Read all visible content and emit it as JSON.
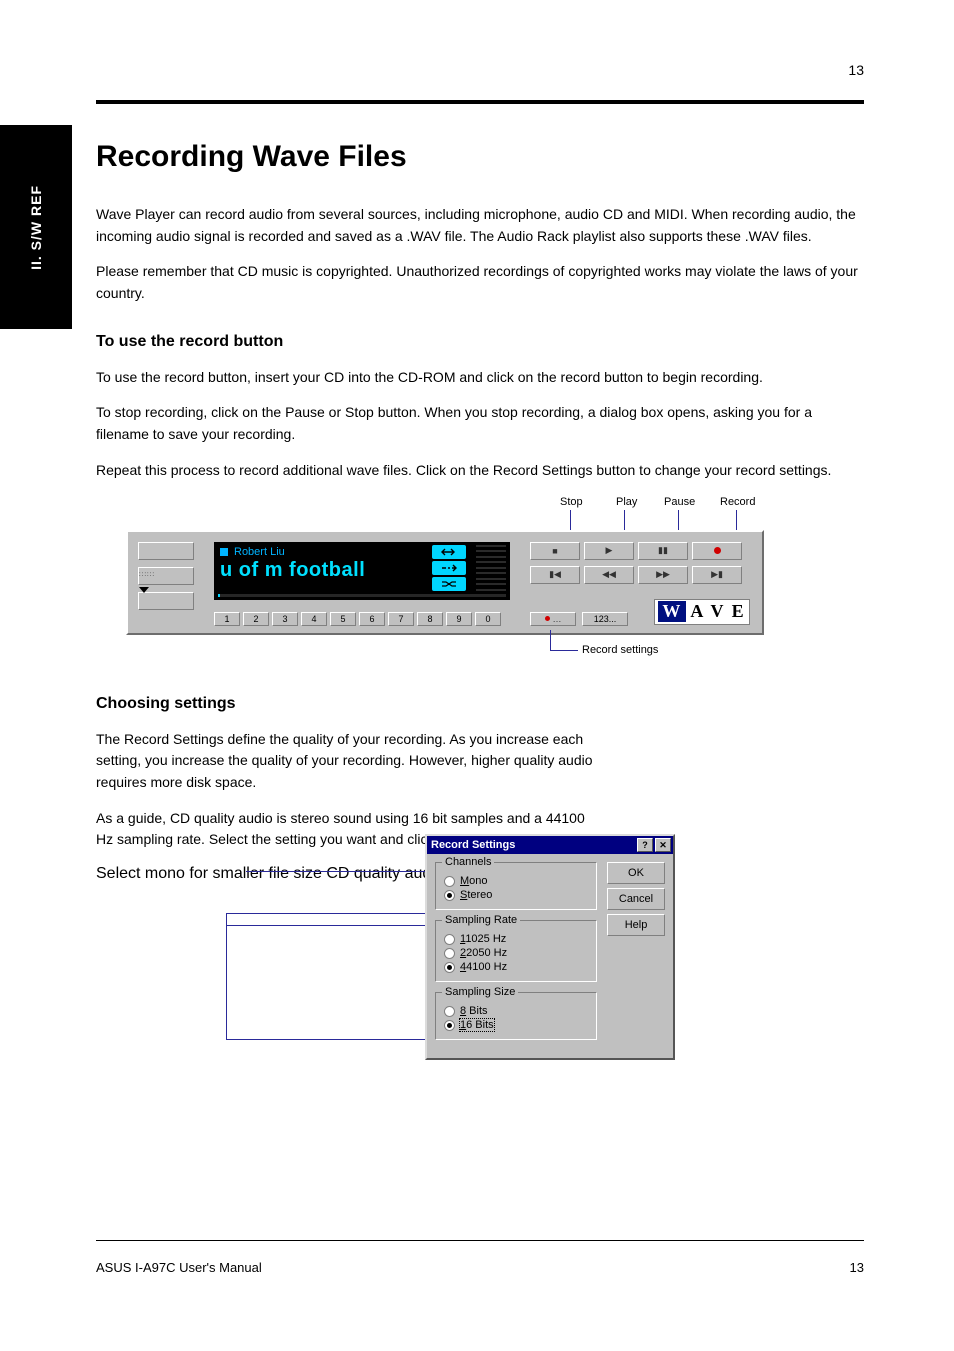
{
  "page_number_top": "13",
  "section_title": "Recording Wave Files",
  "sidebar_label": "II. S/W REF",
  "intro_para1": "Wave Player can record audio from several sources, including microphone, audio CD and MIDI. When recording audio, the incoming audio signal is recorded and saved as a .WAV file. The Audio Rack playlist also supports these .WAV files.",
  "intro_para2": "Please remember that CD music is copyrighted. Unauthorized recordings of copyrighted works may violate the laws of your country.",
  "para_record1": "To use the record button, insert your CD into the CD-ROM and click on the record button to begin recording.",
  "para_record2": "To stop recording, click on the Pause or Stop button. When you stop recording, a dialog box opens, asking you for a filename to save your recording.",
  "para_record3": "Repeat this process to record additional wave files. Click on the Record Settings button to change your record settings.",
  "subhead_use_record": "To use the record button",
  "subhead_settings": "Choosing settings",
  "label_stop": "Stop",
  "label_play": "Play",
  "label_pause": "Pause",
  "label_record": "Record",
  "label_record_settings": "Record settings",
  "wave": {
    "artist": "Robert Liu",
    "title": "u of m football",
    "nums": [
      "1",
      "2",
      "3",
      "4",
      "5",
      "6",
      "7",
      "8",
      "9",
      "0"
    ],
    "bot_btn2": "123...",
    "logo_rest": " A V E"
  },
  "settings": {
    "para1": "The Record Settings define the quality of your recording. As you increase each setting, you increase the quality of your recording. However, higher quality audio requires more disk space.",
    "para2": "As a guide, CD quality audio is stereo sound using 16 bit samples and a 44100 Hz sampling rate. Select the setting you want and click OK.",
    "callout_mono": "Select mono for smaller file size",
    "callout_cd": "CD quality audio settings",
    "dialog_title": "Record Settings",
    "legend_channels": "Channels",
    "legend_rate": "Sampling Rate",
    "legend_size": "Sampling Size",
    "opt_mono": "Mono",
    "opt_stereo": "Stereo",
    "rate1": "11025 Hz",
    "rate2": "22050 Hz",
    "rate3": "44100 Hz",
    "size1": "8 Bits",
    "size2": "16 Bits",
    "btn_ok": "OK",
    "btn_cancel": "Cancel",
    "btn_help": "Help"
  },
  "footer_left": "ASUS I-A97C User's Manual",
  "footer_right": "13",
  "footer_pagechunk": "Recording Wave Files"
}
